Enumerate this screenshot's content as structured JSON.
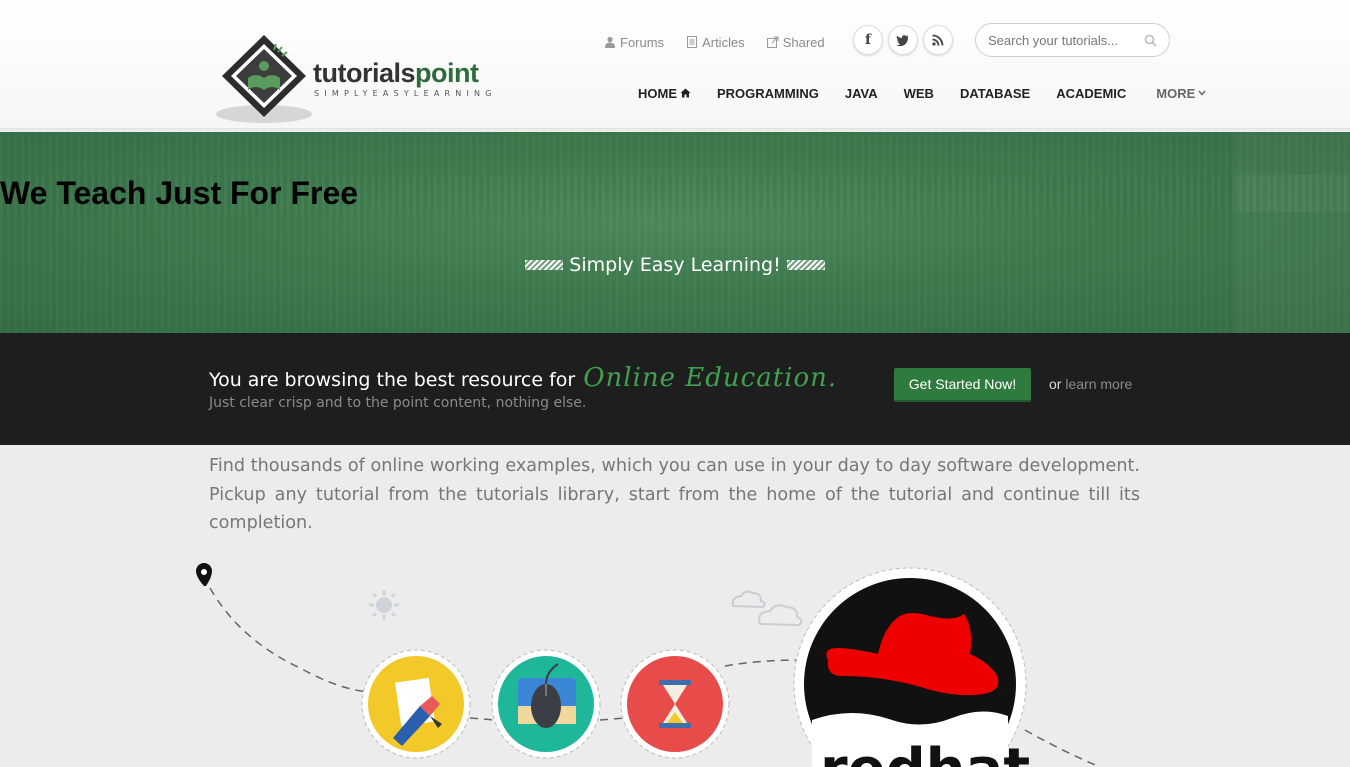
{
  "header": {
    "logo_text_main": "tutorials",
    "logo_text_accent": "point",
    "logo_tagline": "SIMPLYEASYLEARNING",
    "toplinks": [
      {
        "label": "Forums",
        "icon": "user-icon"
      },
      {
        "label": "Articles",
        "icon": "document-icon"
      },
      {
        "label": "Shared",
        "icon": "external-link-icon"
      }
    ],
    "social": [
      {
        "label": "f",
        "icon": "facebook-icon"
      },
      {
        "label": "t",
        "icon": "twitter-icon"
      },
      {
        "label": "rss",
        "icon": "rss-icon"
      }
    ],
    "search_placeholder": "Search your tutorials...",
    "nav": [
      {
        "label": "HOME",
        "icon": "home-icon"
      },
      {
        "label": "PROGRAMMING"
      },
      {
        "label": "JAVA"
      },
      {
        "label": "WEB"
      },
      {
        "label": "DATABASE"
      },
      {
        "label": "ACADEMIC"
      },
      {
        "label": "MORE",
        "icon": "chevron-down-icon"
      }
    ]
  },
  "hero": {
    "title": "We Teach Just For Free",
    "subtitle": "Simply Easy Learning!"
  },
  "banner": {
    "lead": "You are browsing the best resource for",
    "highlight": "Online  Education.",
    "sub": "Just clear crisp and to the point content, nothing else.",
    "cta_label": "Get Started Now!",
    "or_text": "or",
    "learn_more": "learn more"
  },
  "description": "Find thousands of online working examples, which you can use in your day to day software development. Pickup any tutorial from the tutorials library, start from the home of the tutorial and continue till its completion.",
  "illustration": {
    "icons": [
      "location-pin-icon",
      "sun-icon",
      "cloud-icon",
      "design-pen-icon",
      "mouse-icon",
      "hourglass-icon",
      "redhat-logo"
    ],
    "redhat_partial_text": "redhat",
    "colors": {
      "pen_circle": "#f3c829",
      "mouse_circle": "#1fb79a",
      "hourglass_circle": "#e84c4a",
      "redhat": "#ee0000"
    }
  },
  "colors": {
    "brand_green": "#2f7a3f",
    "hero_green": "#3e7a4e",
    "banner_bg": "#1e1e1e"
  }
}
